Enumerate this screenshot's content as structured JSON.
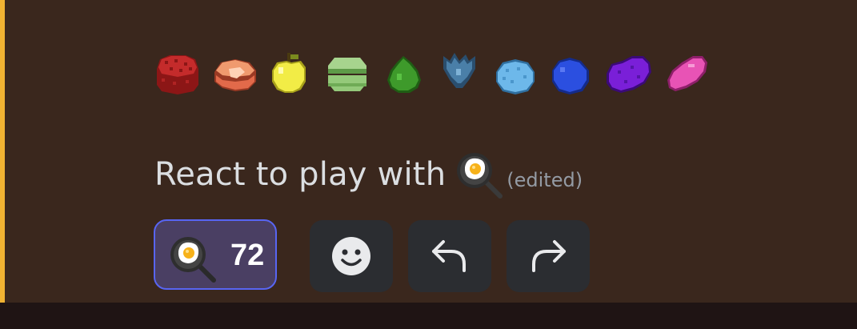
{
  "message": {
    "accent_color": "#f0b232",
    "sprites": [
      {
        "name": "red-sponge-icon",
        "color": "#c42b2b"
      },
      {
        "name": "ham-slice-icon",
        "color": "#e26a4a"
      },
      {
        "name": "yellow-apple-icon",
        "color": "#f2ec46"
      },
      {
        "name": "green-macaron-icon",
        "color": "#94c97a"
      },
      {
        "name": "green-leaf-icon",
        "color": "#3e9a2b"
      },
      {
        "name": "blue-crystal-icon",
        "color": "#4a7fa8"
      },
      {
        "name": "light-blue-egg-icon",
        "color": "#6db8ea"
      },
      {
        "name": "blue-berry-icon",
        "color": "#2b4fe0"
      },
      {
        "name": "purple-potato-icon",
        "color": "#7a1fd8"
      },
      {
        "name": "pink-bean-icon",
        "color": "#e853b5"
      }
    ],
    "text": "React to play with",
    "inline_emoji": "frying-pan-egg-icon",
    "edited_label": "(edited)"
  },
  "reaction": {
    "emoji": "frying-pan-egg-icon",
    "count": "72",
    "active": true
  },
  "actions": [
    {
      "name": "add-reaction-button",
      "icon": "smiley-face-icon"
    },
    {
      "name": "reply-button",
      "icon": "reply-arrow-icon"
    },
    {
      "name": "forward-button",
      "icon": "forward-arrow-icon"
    }
  ]
}
